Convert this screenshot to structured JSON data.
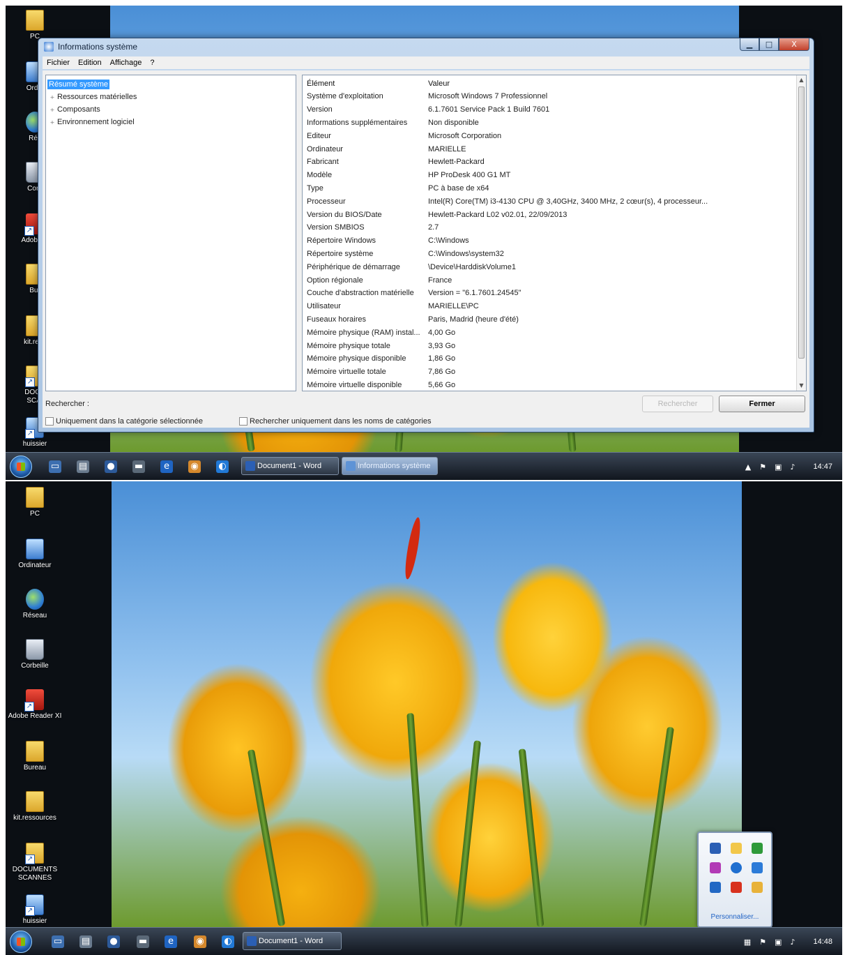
{
  "screen1": {
    "desktop_icons": [
      {
        "label": "PC",
        "icon": "folder-user-icon"
      },
      {
        "label": "Ordin",
        "icon": "computer-icon"
      },
      {
        "label": "Rés",
        "icon": "network-icon"
      },
      {
        "label": "Corb",
        "icon": "recycle-bin-icon"
      },
      {
        "label": "Adobe R",
        "icon": "pdf-shortcut-icon"
      },
      {
        "label": "Bur",
        "icon": "folder-icon"
      },
      {
        "label": "kit.ress",
        "icon": "folder-icon"
      },
      {
        "label": "DOCU\nSCAI",
        "icon": "folder-user-icon"
      },
      {
        "label": "huissier",
        "icon": "shortcut-icon"
      }
    ],
    "window": {
      "title": "Informations système",
      "controls": {
        "minimize": "▁",
        "maximize": "□",
        "close": "X"
      },
      "menu": [
        "Fichier",
        "Edition",
        "Affichage",
        "?"
      ],
      "tree": [
        {
          "label": "Résumé système",
          "selected": true
        },
        {
          "label": "Ressources matérielles",
          "expander": "+"
        },
        {
          "label": "Composants",
          "expander": "+"
        },
        {
          "label": "Environnement logiciel",
          "expander": "+"
        }
      ],
      "columns": {
        "element": "Élément",
        "value": "Valeur"
      },
      "rows": [
        [
          "Système d'exploitation",
          "Microsoft Windows 7 Professionnel"
        ],
        [
          "Version",
          "6.1.7601 Service Pack 1 Build 7601"
        ],
        [
          "Informations supplémentaires",
          "Non disponible"
        ],
        [
          "Editeur",
          "Microsoft Corporation"
        ],
        [
          "Ordinateur",
          "MARIELLE"
        ],
        [
          "Fabricant",
          "Hewlett-Packard"
        ],
        [
          "Modèle",
          "HP ProDesk 400 G1 MT"
        ],
        [
          "Type",
          "PC à base de x64"
        ],
        [
          "Processeur",
          "Intel(R) Core(TM) i3-4130 CPU @ 3,40GHz, 3400 MHz, 2 cœur(s), 4 processeur..."
        ],
        [
          "Version du BIOS/Date",
          "Hewlett-Packard L02 v02.01, 22/09/2013"
        ],
        [
          "Version SMBIOS",
          "2.7"
        ],
        [
          "Répertoire Windows",
          "C:\\Windows"
        ],
        [
          "Répertoire système",
          "C:\\Windows\\system32"
        ],
        [
          "Périphérique de démarrage",
          "\\Device\\HarddiskVolume1"
        ],
        [
          "Option régionale",
          "France"
        ],
        [
          "Couche d'abstraction matérielle",
          "Version = \"6.1.7601.24545\""
        ],
        [
          "Utilisateur",
          "MARIELLE\\PC"
        ],
        [
          "Fuseaux horaires",
          "Paris, Madrid (heure d'été)"
        ],
        [
          "Mémoire physique (RAM) instal...",
          "4,00 Go"
        ],
        [
          "Mémoire physique totale",
          "3,93 Go"
        ],
        [
          "Mémoire physique disponible",
          "1,86 Go"
        ],
        [
          "Mémoire virtuelle totale",
          "7,86 Go"
        ],
        [
          "Mémoire virtuelle disponible",
          "5,66 Go"
        ]
      ],
      "search": {
        "label": "Rechercher :",
        "value": "",
        "search_button": "Rechercher",
        "close_button": "Fermer",
        "only_selected_category": "Uniquement dans la catégorie sélectionnée",
        "only_category_names": "Rechercher uniquement dans les noms de catégories"
      }
    },
    "taskbar": {
      "tasks": [
        {
          "label": "Document1 - Word",
          "icon": "word-icon",
          "active": false
        },
        {
          "label": "Informations système",
          "icon": "sysinfo-icon",
          "active": true
        }
      ],
      "clock": "14:47"
    }
  },
  "screen2": {
    "desktop_icons": [
      {
        "label": "PC",
        "icon": "folder-user-icon"
      },
      {
        "label": "Ordinateur",
        "icon": "computer-icon"
      },
      {
        "label": "Réseau",
        "icon": "network-icon"
      },
      {
        "label": "Corbeille",
        "icon": "recycle-bin-icon"
      },
      {
        "label": "Adobe Reader XI",
        "icon": "pdf-shortcut-icon"
      },
      {
        "label": "Bureau",
        "icon": "folder-icon"
      },
      {
        "label": "kit.ressources",
        "icon": "folder-icon"
      },
      {
        "label": "DOCUMENTS\nSCANNES",
        "icon": "folder-user-icon"
      },
      {
        "label": "huissier",
        "icon": "shortcut-icon"
      }
    ],
    "overflow_popup": {
      "customize": "Personnaliser..."
    },
    "taskbar": {
      "tasks": [
        {
          "label": "Document1 - Word",
          "icon": "word-icon",
          "active": false
        }
      ],
      "clock": "14:48"
    }
  },
  "colors": {
    "selection": "#3399ff",
    "taskbar": "#1b222c",
    "window_frame": "#a9c4e3"
  }
}
